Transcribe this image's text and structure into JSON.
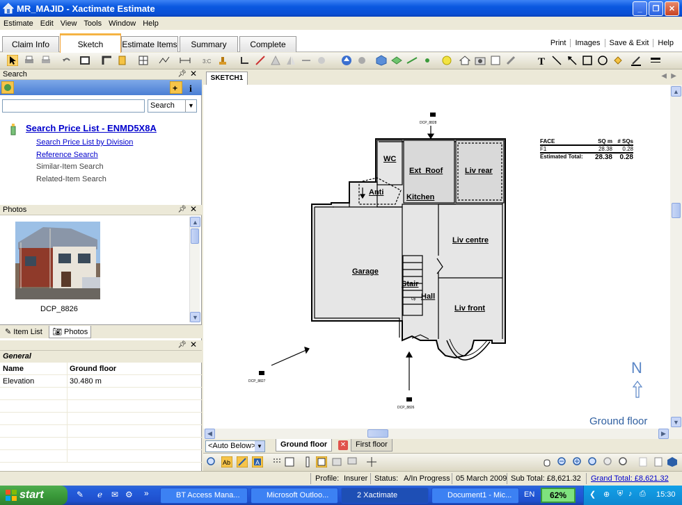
{
  "window": {
    "title": "MR_MAJID - Xactimate Estimate",
    "buttons": [
      "minimize",
      "restore",
      "close"
    ]
  },
  "menu": [
    "Estimate",
    "Edit",
    "View",
    "Tools",
    "Window",
    "Help"
  ],
  "main_tabs": [
    {
      "label": "Claim Info",
      "active": false
    },
    {
      "label": "Sketch",
      "active": true
    },
    {
      "label": "Estimate Items",
      "active": false
    },
    {
      "label": "Summary",
      "active": false
    },
    {
      "label": "Complete",
      "active": false
    }
  ],
  "right_links": [
    "Print",
    "Images",
    "Save & Exit",
    "Help"
  ],
  "search_panel": {
    "title": "Search",
    "input_value": "",
    "select_value": "Search",
    "main_link": "Search Price List - ENMD5X8A",
    "links": [
      "Search Price List by Division",
      "Reference Search"
    ],
    "items": [
      "Similar-Item Search",
      "Related-Item Search"
    ]
  },
  "photos_panel": {
    "title": "Photos",
    "photo_caption": "DCP_8826",
    "tabs": [
      {
        "label": "Item List",
        "active": false
      },
      {
        "label": "Photos",
        "active": true
      }
    ]
  },
  "props_panel": {
    "section": "General",
    "rows": [
      {
        "key": "Name",
        "value": "Ground floor",
        "bold": true
      },
      {
        "key": "Elevation",
        "value": "30.480 m",
        "bold": false
      }
    ]
  },
  "sketch": {
    "tab": "SKETCH1",
    "level_name": "Ground floor",
    "compass_letter": "N",
    "rooms": {
      "wc": "WC",
      "ext_roof": "Ext_Roof",
      "liv_rear": "Liv rear",
      "anti": "Anti",
      "kitchen": "Kitchen",
      "garage": "Garage",
      "liv_centre": "Liv centre",
      "stair": "Stair",
      "hall": "Hall",
      "liv_front": "Liv front",
      "up": "Up"
    },
    "cameras": [
      "DCP_8828",
      "DCP_8827",
      "DCP_8826"
    ],
    "table": {
      "headers": [
        "FACE",
        "SQ m",
        "# SQs"
      ],
      "rows": [
        {
          "face": "F1",
          "sqm": "28.38",
          "sqs": "0.28"
        }
      ],
      "total_label": "Estimated Total:",
      "total_sqm": "28.38",
      "total_sqs": "0.28"
    }
  },
  "floor_tabs": {
    "level_select": "<Auto Below>",
    "tabs": [
      {
        "label": "Ground floor",
        "active": true
      },
      {
        "label": "First floor",
        "active": false
      }
    ]
  },
  "status_bar": {
    "profile_label": "Profile:",
    "profile_value": "Insurer",
    "status_label": "Status:",
    "status_value": "A/In Progress",
    "date": "05 March 2009",
    "subtotal": "Sub Total: £8,621.32",
    "grandtotal": "Grand Total: £8,621.32"
  },
  "taskbar": {
    "start": "start",
    "items": [
      {
        "label": "BT Access Mana...",
        "active": false
      },
      {
        "label": "Microsoft Outloo...",
        "active": false
      },
      {
        "label": "2 Xactimate",
        "active": true
      },
      {
        "label": "Document1 - Mic...",
        "active": false
      }
    ],
    "lang": "EN",
    "battery": "62%",
    "clock": "15:30"
  },
  "colors": {
    "title_blue": "#0a58e0",
    "link_blue": "#0000cc",
    "sketch_label_blue": "#2f5fa0",
    "start_green": "#3a9a3a"
  }
}
